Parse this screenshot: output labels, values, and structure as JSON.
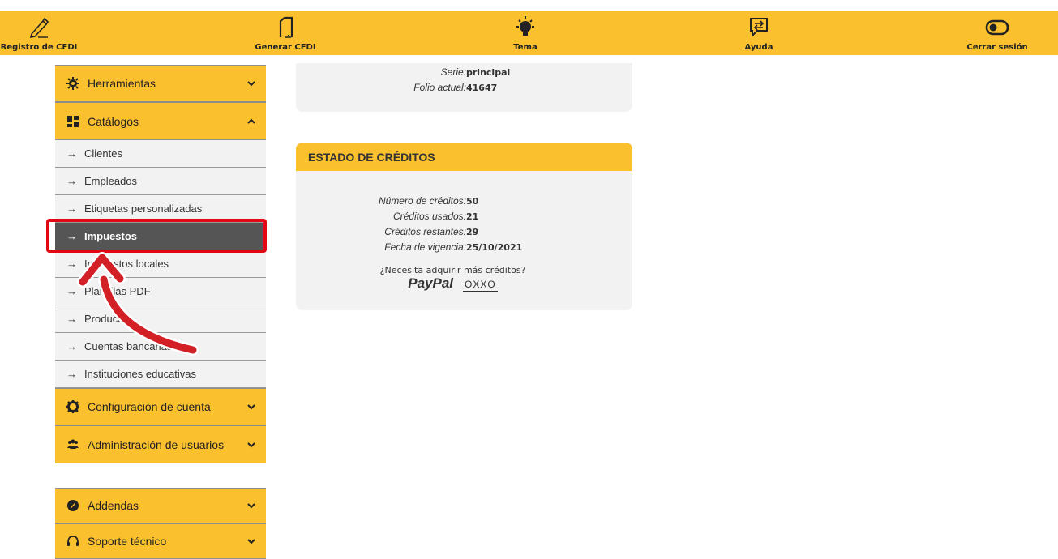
{
  "topnav": {
    "items": [
      {
        "label": "Registro de CFDI",
        "icon": "pencil-icon"
      },
      {
        "label": "Generar CFDI",
        "icon": "document-icon"
      },
      {
        "label": "Tema",
        "icon": "lightbulb-icon"
      },
      {
        "label": "Ayuda",
        "icon": "chat-help-icon"
      },
      {
        "label": "Cerrar sesión",
        "icon": "toggle-icon"
      }
    ],
    "bg_color": "#fbc02d"
  },
  "sidebar": {
    "herramientas": "Herramientas",
    "catalogos": "Catálogos",
    "catalog_items": [
      "Clientes",
      "Empleados",
      "Etiquetas personalizadas",
      "Impuestos",
      "Impuestos locales",
      "Plantillas PDF",
      "Productos",
      "Cuentas bancarias",
      "Instituciones educativas"
    ],
    "active_item": "Impuestos",
    "configuracion": "Configuración de cuenta",
    "admin_usuarios": "Administración de usuarios",
    "addendas": "Addendas",
    "soporte": "Soporte técnico"
  },
  "folio_panel": {
    "serie_label": "Serie:",
    "serie_value": "principal",
    "folio_label": "Folio actual:",
    "folio_value": "41647"
  },
  "credits": {
    "title": "ESTADO DE CRÉDITOS",
    "rows": [
      {
        "label": "Número de créditos:",
        "value": "50"
      },
      {
        "label": "Créditos usados:",
        "value": "21"
      },
      {
        "label": "Créditos restantes:",
        "value": "29"
      },
      {
        "label": "Fecha de vigencia:",
        "value": "25/10/2021"
      }
    ],
    "need_more": "¿Necesita adquirir más créditos?",
    "paypal": "PayPal",
    "oxxo": "OXXO"
  },
  "colors": {
    "accent": "#fbc02d",
    "active_item": "#555555",
    "highlight": "#e30613"
  }
}
